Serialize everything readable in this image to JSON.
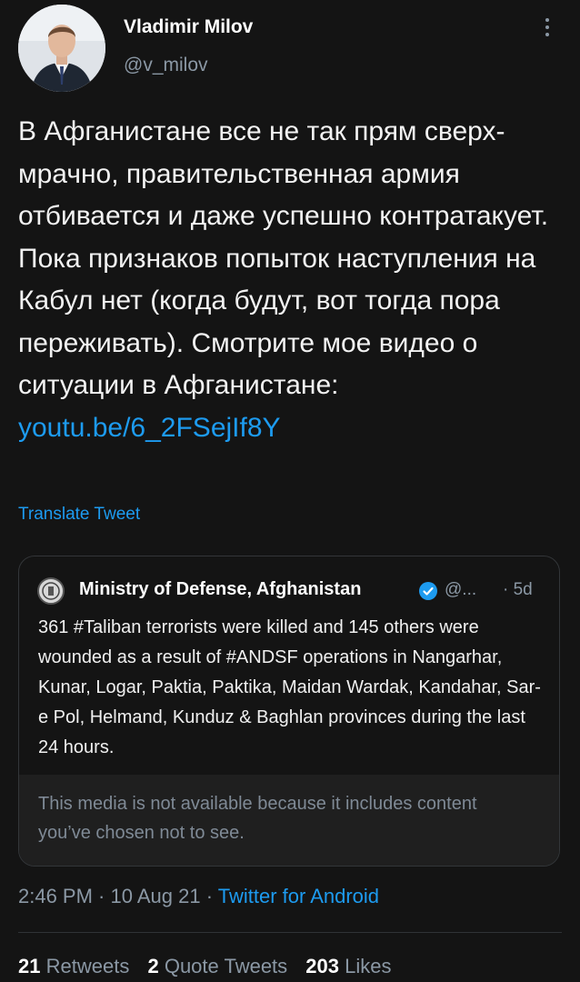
{
  "author": {
    "name": "Vladimir Milov",
    "handle": "@v_milov"
  },
  "tweet": {
    "text": "В Афганистане все не так прям сверх-мрачно, правительственная армия отбивается и даже успешно контратакует. Пока признаков попыток наступления на Кабул нет (когда будут, вот тогда пора переживать). Смотрите мое видео о ситуации в Афганистане: ",
    "link": "youtu.be/6_2FSejIf8Y",
    "translate_label": "Translate Tweet"
  },
  "quoted": {
    "name": "Ministry of Defense, Afghanistan",
    "handle": "@...",
    "time": "· 5d",
    "text": "361 #Taliban terrorists were killed and 145 others were wounded as a result of #ANDSF operations in Nangarhar, Kunar, Logar, Paktia, Paktika, Maidan Wardak, Kandahar, Sar-e Pol, Helmand, Kunduz & Baghlan provinces during the last 24 hours.",
    "media_notice": "This media is not available because it includes content you’ve chosen not to see."
  },
  "meta": {
    "time_date": "2:46 PM · 10 Aug 21 · ",
    "source": "Twitter for Android"
  },
  "stats": {
    "retweets_count": "21",
    "retweets_label": "Retweets",
    "quotes_count": "2",
    "quotes_label": "Quote Tweets",
    "likes_count": "203",
    "likes_label": "Likes"
  },
  "colors": {
    "background": "#141414",
    "link": "#1d9bf0",
    "muted": "#8b98a5"
  }
}
